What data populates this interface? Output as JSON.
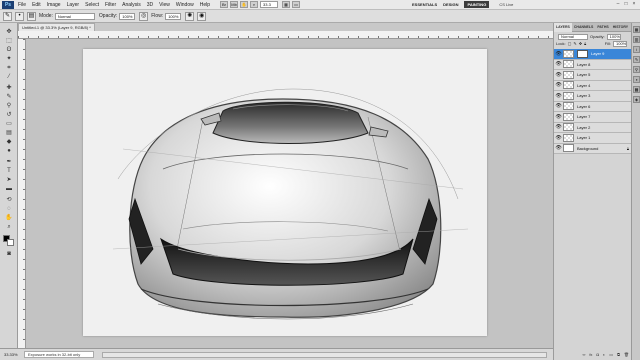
{
  "menu": {
    "items": [
      "File",
      "Edit",
      "Image",
      "Layer",
      "Select",
      "Filter",
      "Analysis",
      "3D",
      "View",
      "Window",
      "Help"
    ],
    "zoom": "33.3",
    "workspaces": [
      "ESSENTIALS",
      "DESIGN",
      "PAINTING"
    ],
    "active_workspace": "PAINTING",
    "cs_live": "CS Live"
  },
  "options": {
    "mode_label": "Mode:",
    "mode_value": "Normal",
    "opacity_label": "Opacity:",
    "opacity_value": "100%",
    "flow_label": "Flow:",
    "flow_value": "100%"
  },
  "document": {
    "tab_title": "Untitled-1 @ 33.3% (Layer 9, RGB/8) *"
  },
  "status": {
    "zoom": "33.33%",
    "info": "Exposure works in 32-bit only"
  },
  "layers_panel": {
    "tabs": [
      "LAYERS",
      "CHANNELS",
      "PATHS",
      "HISTORY"
    ],
    "blend_mode": "Normal",
    "opacity_label": "Opacity:",
    "opacity_value": "100%",
    "lock_label": "Lock:",
    "fill_label": "Fill:",
    "fill_value": "100%",
    "layers": [
      {
        "name": "Layer 9",
        "selected": true,
        "mask": true
      },
      {
        "name": "Layer 8",
        "selected": false
      },
      {
        "name": "Layer 5",
        "selected": false
      },
      {
        "name": "Layer 4",
        "selected": false
      },
      {
        "name": "Layer 3",
        "selected": false
      },
      {
        "name": "Layer 6",
        "selected": false
      },
      {
        "name": "Layer 7",
        "selected": false
      },
      {
        "name": "Layer 2",
        "selected": false
      },
      {
        "name": "Layer 1",
        "selected": false
      },
      {
        "name": "Background",
        "selected": false,
        "background": true
      }
    ]
  },
  "colors": {
    "selection": "#3a86d8",
    "workspace": "#c3c3c3",
    "canvas": "#f0f0f0"
  }
}
